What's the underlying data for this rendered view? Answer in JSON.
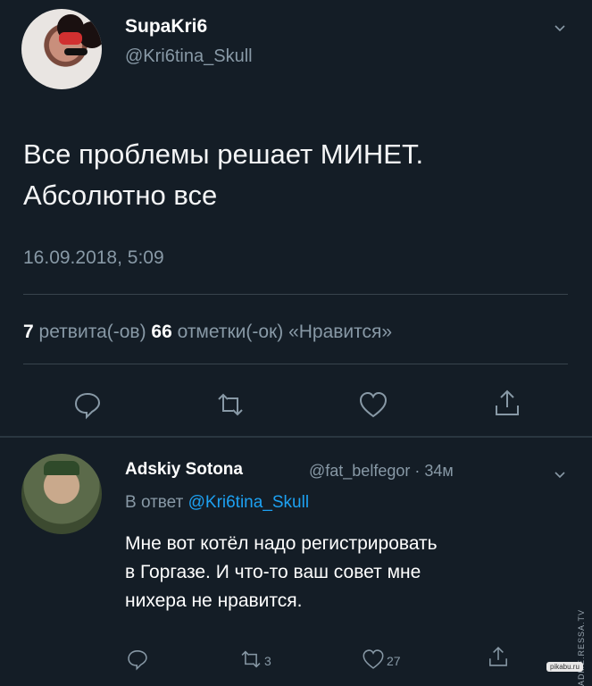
{
  "main_tweet": {
    "display_name": "SupaKri6",
    "handle": "@Kri6tina_Skull",
    "text": "Все проблемы решает МИНЕТ.\nАбсолютно все",
    "timestamp": "16.09.2018, 5:09",
    "retweets_count": "7",
    "retweets_label": " ретвита(-ов) ",
    "likes_count": "66",
    "likes_label": " отметки(-ок) «Нравится»"
  },
  "reply": {
    "display_name": "Adskiy Sotona",
    "handle_time": "@fat_belfegor · 34м",
    "reply_prefix": "В ответ ",
    "reply_mention": "@Kri6tina_Skull",
    "text": "Мне вот котёл надо регистрировать\nв Горгазе. И что-то ваш совет мне\nнихера не нравится.",
    "retweet_count": "3",
    "like_count": "27"
  },
  "watermarks": {
    "side": "ADME.RESSA.TV",
    "corner": "pikabu.ru"
  },
  "colors": {
    "background": "#141d26",
    "text": "#ffffff",
    "secondary": "#8899a6",
    "link": "#1da1f2"
  },
  "icons": [
    "chevron-down-icon",
    "reply-icon",
    "retweet-icon",
    "like-icon",
    "share-icon"
  ]
}
